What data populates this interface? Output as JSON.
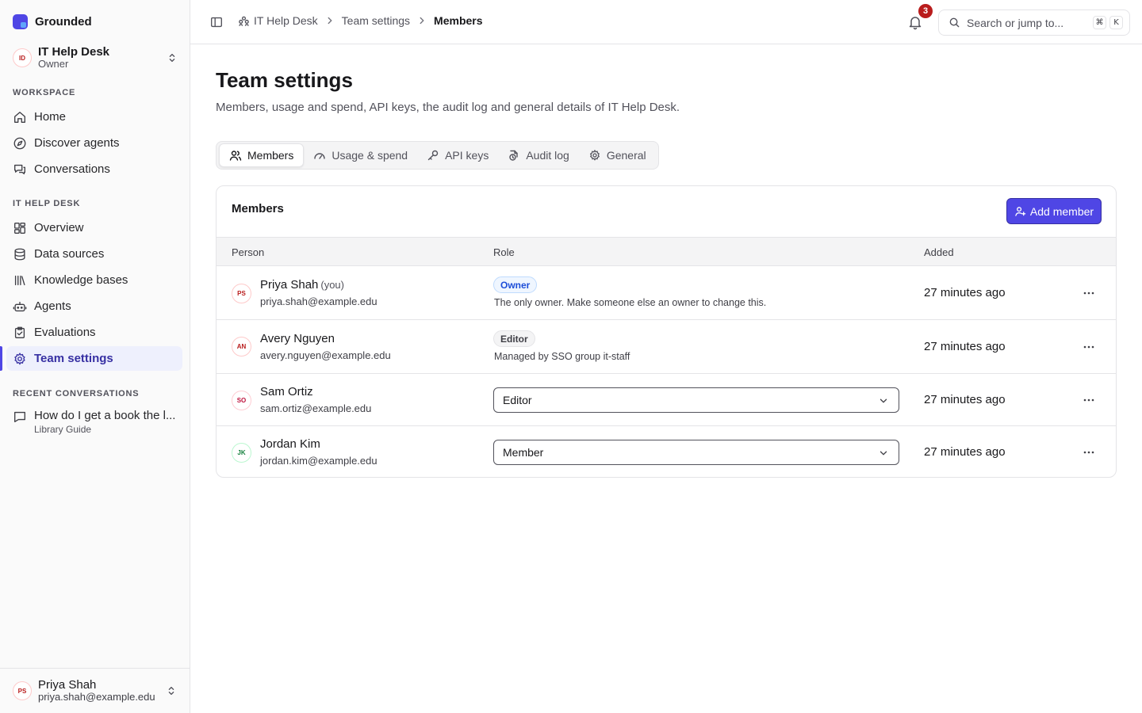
{
  "app": {
    "name": "Grounded"
  },
  "workspace": {
    "name": "IT Help Desk",
    "role": "Owner",
    "initials": "ID"
  },
  "sidebar": {
    "workspace_label": "WORKSPACE",
    "workspace_items": [
      {
        "label": "Home",
        "icon": "home-icon"
      },
      {
        "label": "Discover agents",
        "icon": "compass-icon"
      },
      {
        "label": "Conversations",
        "icon": "chat-bubbles-icon"
      }
    ],
    "team_label": "IT HELP DESK",
    "team_items": [
      {
        "label": "Overview",
        "icon": "dashboard-icon"
      },
      {
        "label": "Data sources",
        "icon": "database-icon"
      },
      {
        "label": "Knowledge bases",
        "icon": "library-icon"
      },
      {
        "label": "Agents",
        "icon": "robot-icon"
      },
      {
        "label": "Evaluations",
        "icon": "clipboard-check-icon"
      },
      {
        "label": "Team settings",
        "icon": "gear-icon",
        "active": true
      }
    ],
    "recent_label": "RECENT CONVERSATIONS",
    "recent": [
      {
        "title": "How do I get a book the l...",
        "subtitle": "Library Guide"
      }
    ]
  },
  "user": {
    "name": "Priya Shah",
    "email": "priya.shah@example.edu",
    "initials": "PS"
  },
  "topbar": {
    "breadcrumb": [
      "IT Help Desk",
      "Team settings",
      "Members"
    ],
    "notifications_count": "3",
    "search_placeholder": "Search or jump to...",
    "shortcut_keys": [
      "⌘",
      "K"
    ]
  },
  "page": {
    "title": "Team settings",
    "subtitle": "Members, usage and spend, API keys, the audit log and general details of IT Help Desk."
  },
  "tabs": [
    {
      "label": "Members",
      "icon": "users-icon",
      "active": true
    },
    {
      "label": "Usage & spend",
      "icon": "gauge-icon"
    },
    {
      "label": "API keys",
      "icon": "key-icon"
    },
    {
      "label": "Audit log",
      "icon": "audit-log-icon"
    },
    {
      "label": "General",
      "icon": "gear-icon"
    }
  ],
  "members": {
    "title": "Members",
    "add_label": "Add member",
    "columns": [
      "Person",
      "Role",
      "Added"
    ],
    "rows": [
      {
        "initials": "PS",
        "name": "Priya Shah",
        "you_tag": "(you)",
        "email": "priya.shah@example.edu",
        "role": "Owner",
        "role_note": "The only owner. Make someone else an owner to change this.",
        "added": "27 minutes ago",
        "avatar_color": "#b91c1c"
      },
      {
        "initials": "AN",
        "name": "Avery Nguyen",
        "email": "avery.nguyen@example.edu",
        "role": "Editor",
        "role_note": "Managed by SSO group it-staff",
        "added": "27 minutes ago",
        "avatar_color": "#b91c1c"
      },
      {
        "initials": "SO",
        "name": "Sam Ortiz",
        "email": "sam.ortiz@example.edu",
        "role_select": "Editor",
        "added": "27 minutes ago",
        "avatar_color": "#be123c"
      },
      {
        "initials": "JK",
        "name": "Jordan Kim",
        "email": "jordan.kim@example.edu",
        "role_select": "Member",
        "added": "27 minutes ago",
        "avatar_color": "#15803d"
      }
    ]
  },
  "colors": {
    "accent": "#4f46e5",
    "owner_badge": "#1d4ed8",
    "editor_badge": "#3f3f46",
    "notification_badge": "#b91c1c"
  }
}
